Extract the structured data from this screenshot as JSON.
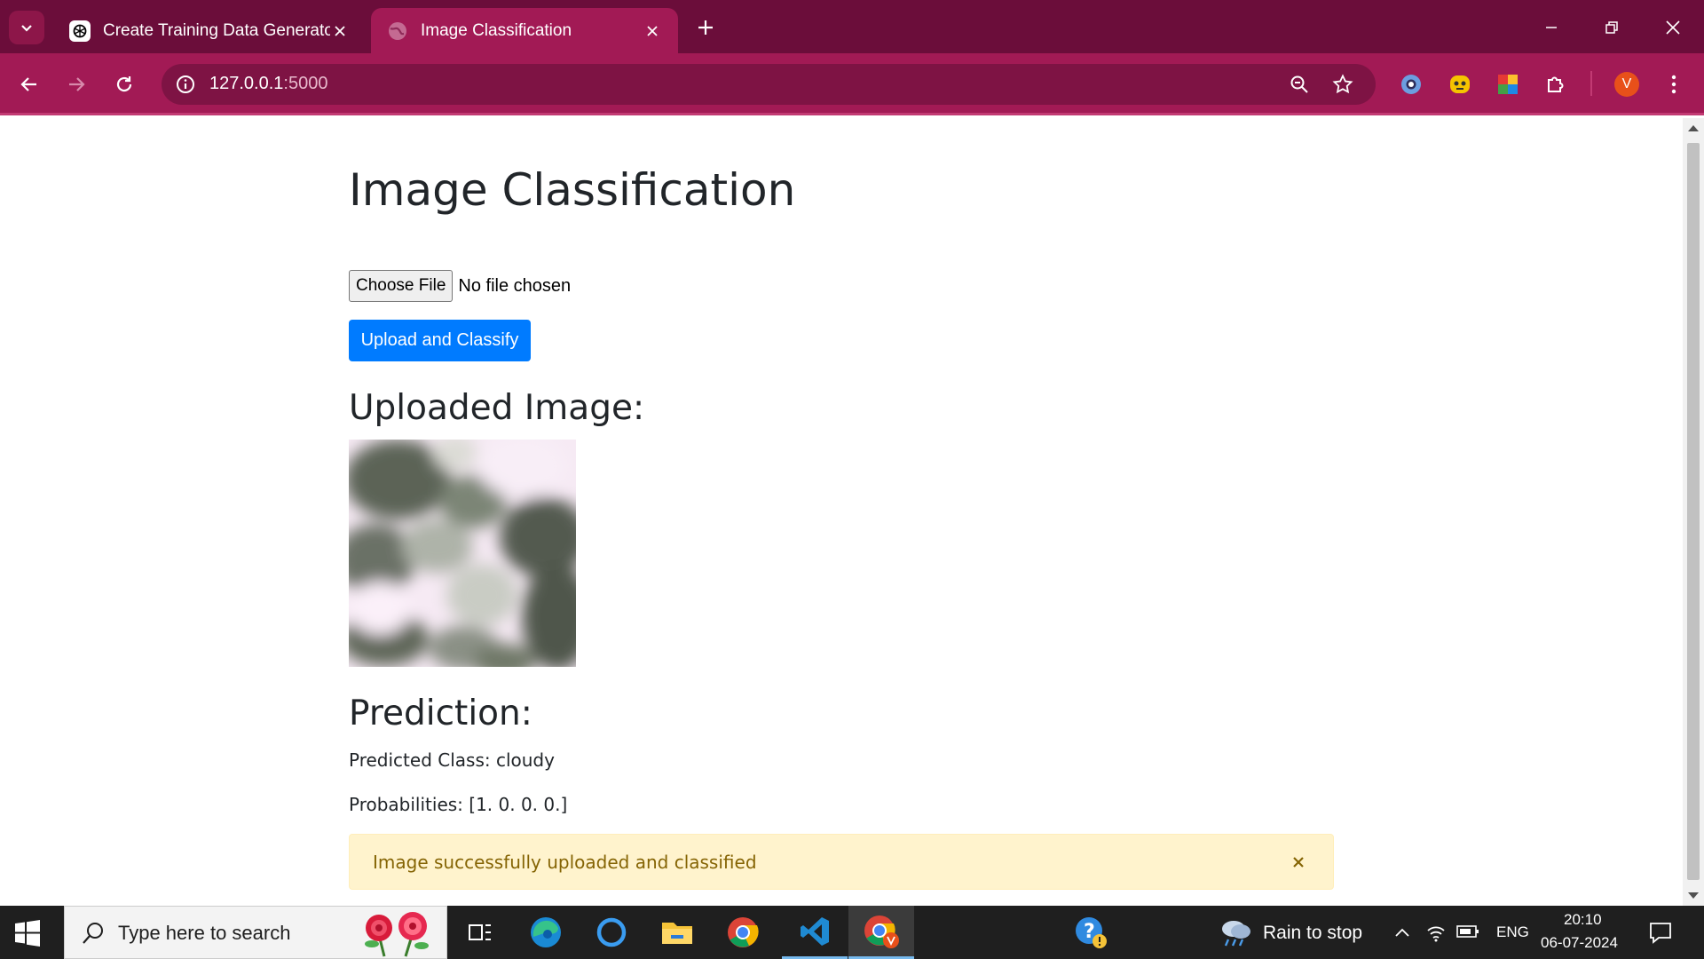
{
  "browser": {
    "tabs": [
      {
        "title": "Create Training Data Generator",
        "active": false
      },
      {
        "title": "Image Classification",
        "active": true
      }
    ],
    "url_host": "127.0.0.1",
    "url_port": ":5000",
    "profile_initial": "V",
    "colors": {
      "tabbar": "#6b0d3a",
      "toolbar": "#a21a55",
      "omnibox": "#7e1344"
    }
  },
  "page": {
    "title": "Image Classification",
    "file_input": {
      "button_label": "Choose File",
      "status": "No file chosen"
    },
    "submit_label": "Upload and Classify",
    "uploaded_heading": "Uploaded Image:",
    "prediction_heading": "Prediction:",
    "predicted_class": "Predicted Class: cloudy",
    "probabilities": "Probabilities: [1. 0. 0. 0.]",
    "alert": "Image successfully uploaded and classified",
    "colors": {
      "primary": "#007bff",
      "alert_bg": "#fff3cd",
      "alert_text": "#856404"
    }
  },
  "taskbar": {
    "search_placeholder": "Type here to search",
    "weather": "Rain to stop",
    "language": "ENG",
    "time": "20:10",
    "date": "06-07-2024",
    "apps": [
      "task-view",
      "edge",
      "cortana",
      "file-explorer",
      "chrome",
      "vscode",
      "chrome-profile"
    ]
  }
}
